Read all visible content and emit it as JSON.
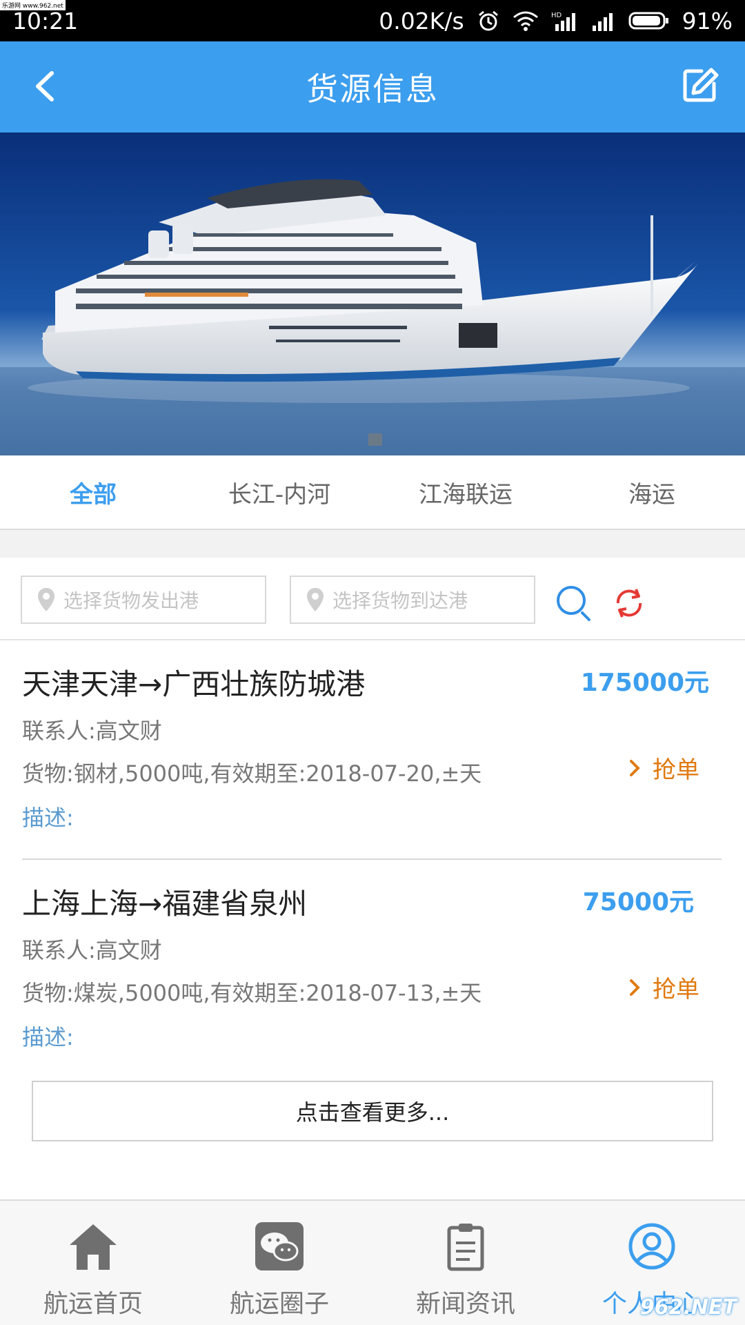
{
  "status_bar": {
    "corner_mark": "乐游网 www.962.net",
    "time": "10:21",
    "speed": "0.02K/s",
    "battery": "91%"
  },
  "header": {
    "title": "货源信息",
    "back_icon": "chevron-left-icon",
    "edit_icon": "edit-icon"
  },
  "tabs": [
    {
      "label": "全部",
      "active": true
    },
    {
      "label": "长江-内河",
      "active": false
    },
    {
      "label": "江海联运",
      "active": false
    },
    {
      "label": "海运",
      "active": false
    }
  ],
  "filters": {
    "origin_placeholder": "选择货物发出港",
    "destination_placeholder": "选择货物到达港"
  },
  "listings": [
    {
      "route": "天津天津→广西壮族防城港",
      "price": "175000元",
      "contact": "联系人:高文财",
      "goods": "货物:钢材,5000吨,有效期至:2018-07-20,±天",
      "desc": "描述:",
      "action": "抢单"
    },
    {
      "route": "上海上海→福建省泉州",
      "price": "75000元",
      "contact": "联系人:高文财",
      "goods": "货物:煤炭,5000吨,有效期至:2018-07-13,±天",
      "desc": "描述:",
      "action": "抢单"
    }
  ],
  "more_label": "点击查看更多...",
  "bottom_nav": [
    {
      "label": "航运首页",
      "icon": "home-icon",
      "active": false
    },
    {
      "label": "航运圈子",
      "icon": "wechat-icon",
      "active": false
    },
    {
      "label": "新闻资讯",
      "icon": "clipboard-icon",
      "active": false
    },
    {
      "label": "个人中心",
      "icon": "user-icon",
      "active": true
    }
  ],
  "watermark": "962.NET",
  "colors": {
    "primary": "#3c9eee",
    "action": "#e07a10",
    "refresh": "#e53935"
  }
}
